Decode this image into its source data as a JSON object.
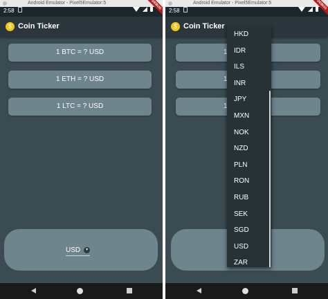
{
  "left": {
    "status_time": "2:58",
    "window_title": "Android Emulator - Pixel5Emulator:5",
    "app_title": "Coin Ticker",
    "rates": [
      "1 BTC = ? USD",
      "1 ETH = ? USD",
      "1 LTC = ? USD"
    ],
    "selected_currency": "USD"
  },
  "right": {
    "status_time": "2:58",
    "window_title": "Android Emulator - Pixel5Emulator:5",
    "app_title": "Coin Ticker",
    "rates": [
      "1",
      "1",
      "1"
    ],
    "dropdown_options": [
      "HKD",
      "IDR",
      "ILS",
      "INR",
      "JPY",
      "MXN",
      "NOK",
      "NZD",
      "PLN",
      "RON",
      "RUB",
      "SEK",
      "SGD",
      "USD",
      "ZAR"
    ]
  },
  "debug_label": "DEBUG",
  "colors": {
    "background": "#3b4b52",
    "card": "#6f858e",
    "appbar": "#2b373c",
    "dropdown": "#263236"
  }
}
